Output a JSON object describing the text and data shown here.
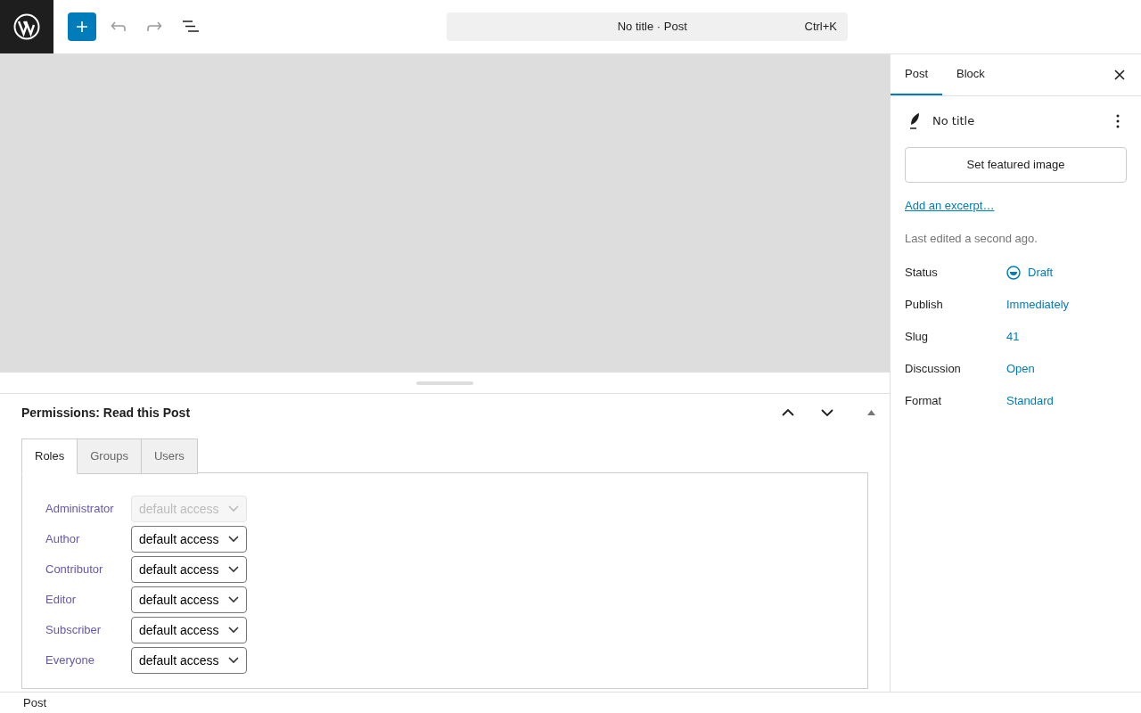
{
  "toolbar": {
    "command_bar": {
      "title": "No title · Post",
      "shortcut": "Ctrl+K"
    }
  },
  "metabox": {
    "title": "Permissions: Read this Post",
    "tabs": [
      {
        "label": "Roles",
        "selected": true
      },
      {
        "label": "Groups",
        "selected": false
      },
      {
        "label": "Users",
        "selected": false
      }
    ],
    "roles": [
      {
        "name": "Administrator",
        "value": "default access",
        "disabled": true
      },
      {
        "name": "Author",
        "value": "default access",
        "disabled": false
      },
      {
        "name": "Contributor",
        "value": "default access",
        "disabled": false
      },
      {
        "name": "Editor",
        "value": "default access",
        "disabled": false
      },
      {
        "name": "Subscriber",
        "value": "default access",
        "disabled": false
      },
      {
        "name": "Everyone",
        "value": "default access",
        "disabled": false
      }
    ]
  },
  "sidebar": {
    "tabs": [
      {
        "label": "Post",
        "selected": true
      },
      {
        "label": "Block",
        "selected": false
      }
    ],
    "post_title": "No title",
    "featured_button": "Set featured image",
    "excerpt_link": "Add an excerpt…",
    "last_edited": "Last edited a second ago.",
    "fields": [
      {
        "label": "Status",
        "value": "Draft",
        "kind": "status"
      },
      {
        "label": "Publish",
        "value": "Immediately",
        "kind": "link"
      },
      {
        "label": "Slug",
        "value": "41",
        "kind": "link"
      },
      {
        "label": "Discussion",
        "value": "Open",
        "kind": "link"
      },
      {
        "label": "Format",
        "value": "Standard",
        "kind": "link"
      }
    ]
  },
  "footer": {
    "breadcrumb": "Post"
  }
}
